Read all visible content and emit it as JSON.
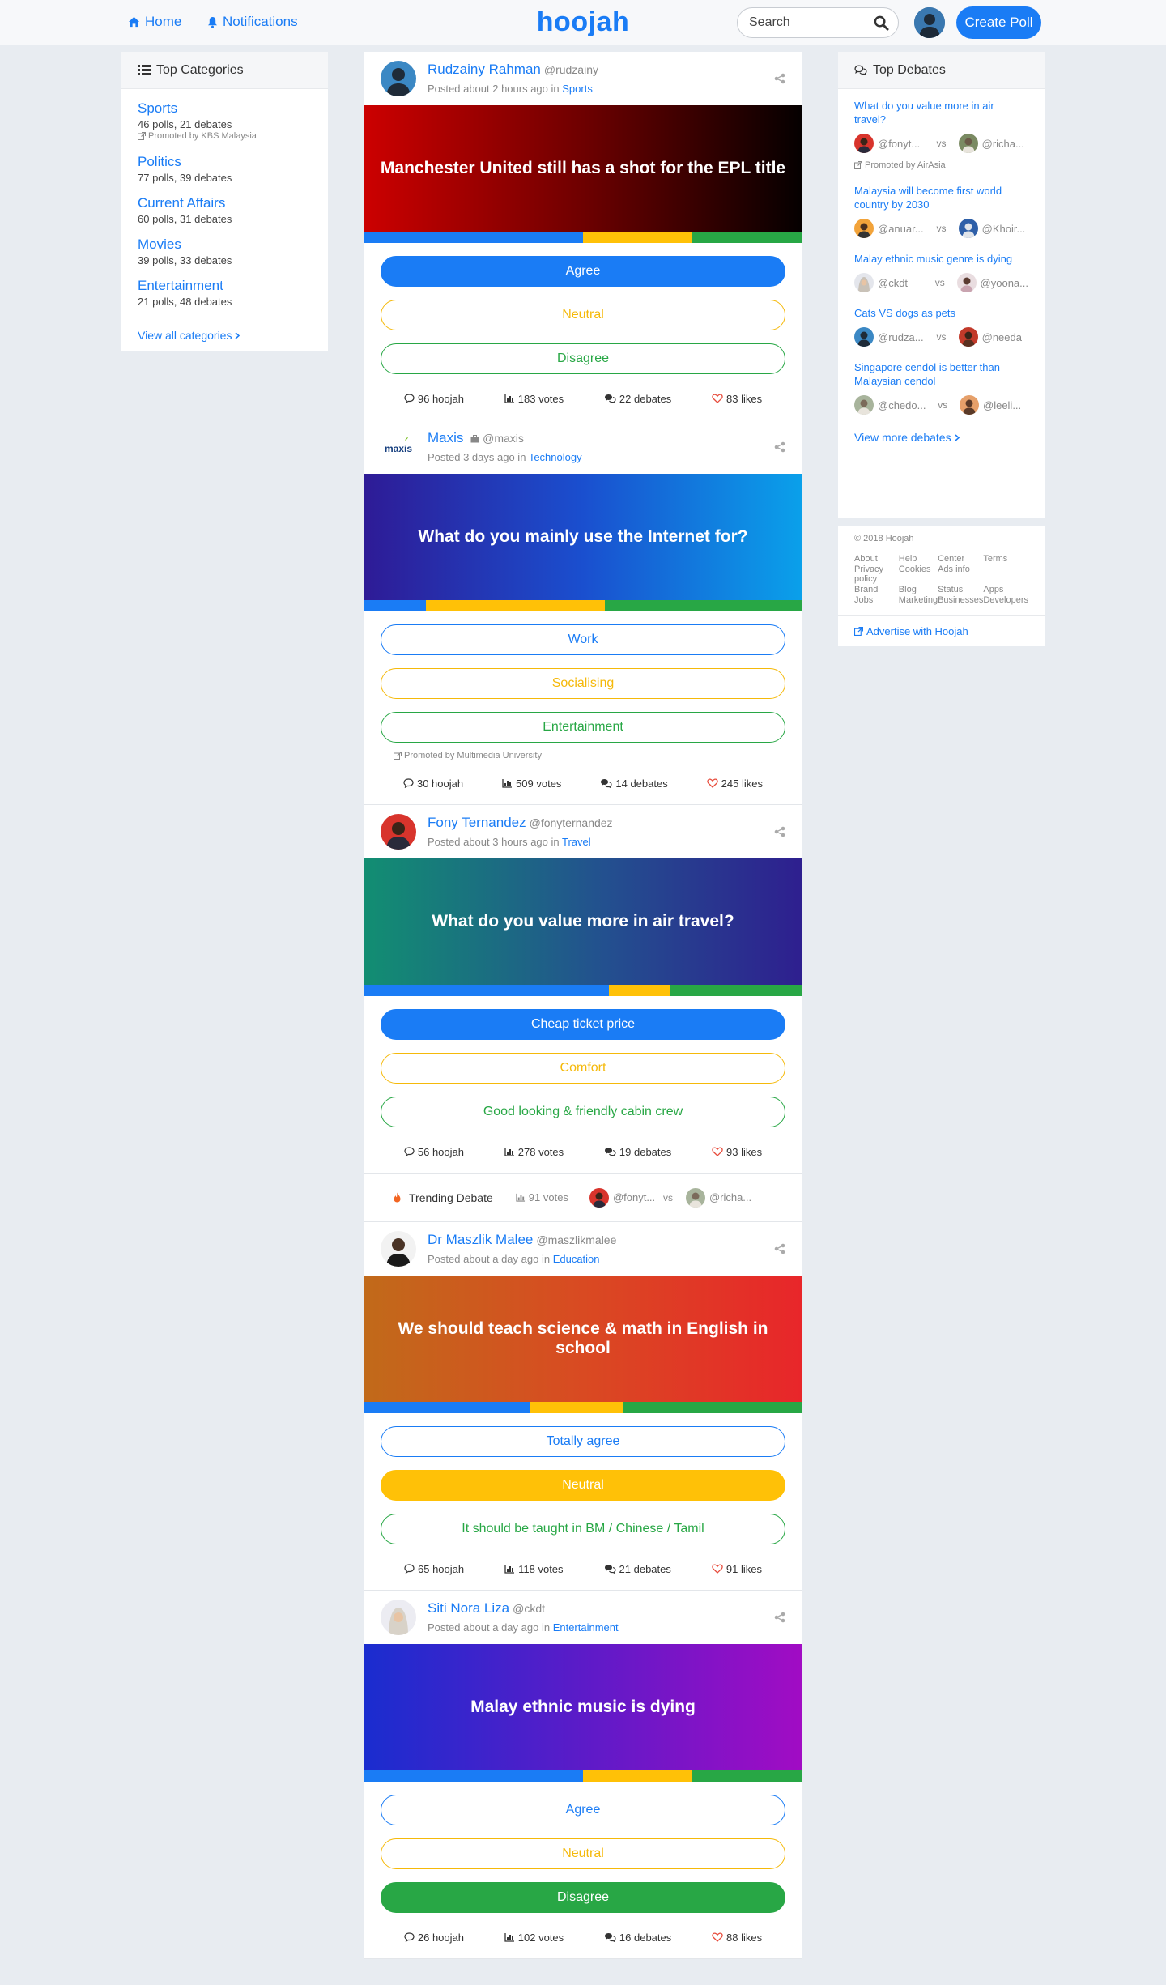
{
  "nav": {
    "home": "Home",
    "notifications": "Notifications",
    "brand": "hoojah",
    "search_placeholder": "Search",
    "create": "Create Poll"
  },
  "colors": {
    "accent": "#1a7cf5",
    "neutral": "#ffc107",
    "disagree": "#28a745",
    "like": "#e74c3c"
  },
  "categories": {
    "title": "Top Categories",
    "items": [
      {
        "name": "Sports",
        "meta": "46 polls, 21 debates",
        "promo": "Promoted by KBS Malaysia"
      },
      {
        "name": "Politics",
        "meta": "77 polls, 39 debates"
      },
      {
        "name": "Current Affairs",
        "meta": "60 polls, 31 debates"
      },
      {
        "name": "Movies",
        "meta": "39 polls, 33 debates"
      },
      {
        "name": "Entertainment",
        "meta": "21 polls, 48 debates"
      }
    ],
    "view_all": "View all categories"
  },
  "posts": [
    {
      "author": "Rudzainy Rahman",
      "handle": "@rudzainy",
      "posted": "Posted about 2 hours ago in",
      "topic": "Sports",
      "question": "Manchester United still has a shot for the EPL title",
      "options": [
        "Agree",
        "Neutral",
        "Disagree"
      ],
      "stats": {
        "hoojah": "96 hoojah",
        "votes": "183 votes",
        "debates": "22 debates",
        "likes": "83 likes"
      }
    },
    {
      "author": "Maxis",
      "handle": "@maxis",
      "posted": "Posted 3 days ago in",
      "topic": "Technology",
      "question": "What do you mainly use the Internet for?",
      "options": [
        "Work",
        "Socialising",
        "Entertainment"
      ],
      "promo": "Promoted by Multimedia University",
      "logo_text": "maxis",
      "stats": {
        "hoojah": "30 hoojah",
        "votes": "509 votes",
        "debates": "14 debates",
        "likes": "245 likes"
      }
    },
    {
      "author": "Fony Ternandez",
      "handle": "@fonyternandez",
      "posted": "Posted about 3 hours ago in",
      "topic": "Travel",
      "question": "What do you value more in air travel?",
      "options": [
        "Cheap ticket price",
        "Comfort",
        "Good looking & friendly cabin crew"
      ],
      "stats": {
        "hoojah": "56 hoojah",
        "votes": "278 votes",
        "debates": "19 debates",
        "likes": "93 likes"
      }
    },
    {
      "author": "Dr Maszlik Malee",
      "handle": "@maszlikmalee",
      "posted": "Posted about a day ago in",
      "topic": "Education",
      "question": "We should teach science & math in English in school",
      "options": [
        "Totally agree",
        "Neutral",
        "It should be taught in BM / Chinese / Tamil"
      ],
      "stats": {
        "hoojah": "65 hoojah",
        "votes": "118 votes",
        "debates": "21 debates",
        "likes": "91 likes"
      }
    },
    {
      "author": "Siti Nora Liza",
      "handle": "@ckdt",
      "posted": "Posted about a day ago in",
      "topic": "Entertainment",
      "question": "Malay ethnic music is dying",
      "options": [
        "Agree",
        "Neutral",
        "Disagree"
      ],
      "stats": {
        "hoojah": "26 hoojah",
        "votes": "102 votes",
        "debates": "16 debates",
        "likes": "88 likes"
      }
    }
  ],
  "trending": {
    "label": "Trending Debate",
    "votes": "91 votes",
    "left": "@fonyt...",
    "vs": "vs",
    "right": "@richa..."
  },
  "debates": {
    "title": "Top Debates",
    "items": [
      {
        "q": "What do you value more in air travel?",
        "left": "@fonyt...",
        "right": "@richa...",
        "promo": "Promoted by AirAsia"
      },
      {
        "q": "Malaysia will become first world country by 2030",
        "left": "@anuar...",
        "right": "@Khoir..."
      },
      {
        "q": "Malay ethnic music genre is dying",
        "left": "@ckdt",
        "right": "@yoona..."
      },
      {
        "q": "Cats VS dogs as pets",
        "left": "@rudza...",
        "right": "@needa"
      },
      {
        "q": "Singapore cendol is better than Malaysian cendol",
        "left": "@chedo...",
        "right": "@leeli..."
      }
    ],
    "vs": "vs",
    "more": "View more debates"
  },
  "footer": {
    "copyright": "© 2018 Hoojah",
    "links": [
      "About",
      "Help",
      "Center",
      "Terms",
      "Privacy policy",
      "Cookies",
      "Ads info",
      "Brand",
      "Blog",
      "Status",
      "Apps",
      "Jobs",
      "Marketing",
      "Businesses",
      "Developers"
    ],
    "advertise": "Advertise with Hoojah"
  }
}
